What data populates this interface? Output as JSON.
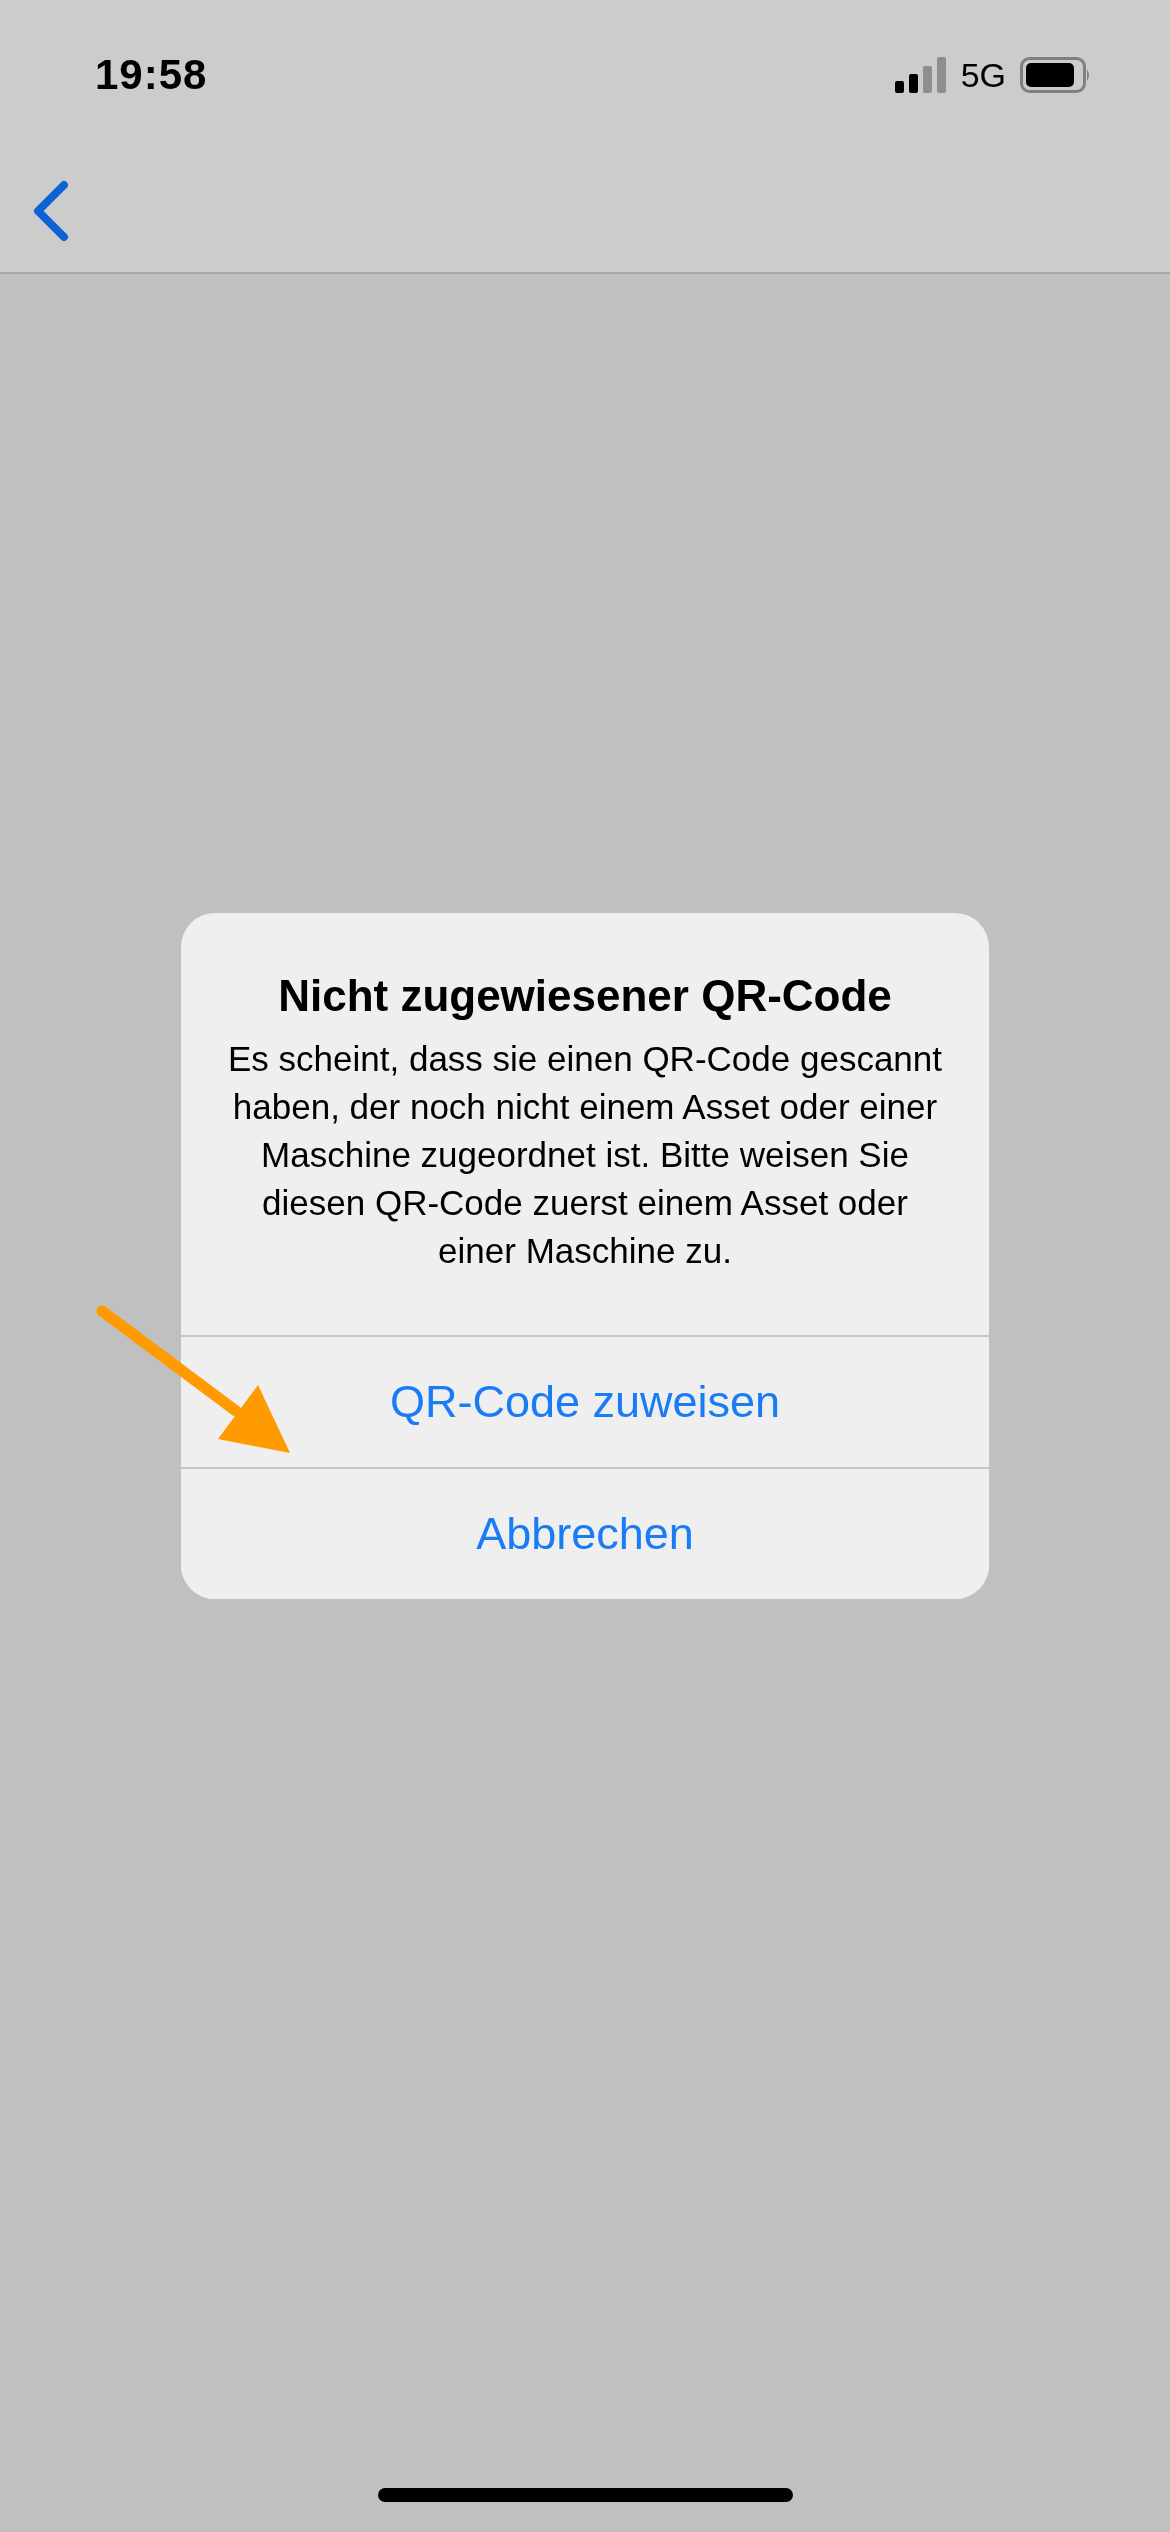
{
  "status_bar": {
    "time": "19:58",
    "network": "5G"
  },
  "dialog": {
    "title": "Nicht zugewiesener QR-Code",
    "message": "Es scheint, dass sie einen QR-Code gescannt haben, der noch nicht einem Asset oder einer Maschine zugeordnet ist. Bitte weisen Sie diesen QR-Code zuerst einem Asset oder einer Maschine zu.",
    "buttons": [
      {
        "label": "QR-Code zuweisen"
      },
      {
        "label": "Abbrechen"
      }
    ]
  }
}
